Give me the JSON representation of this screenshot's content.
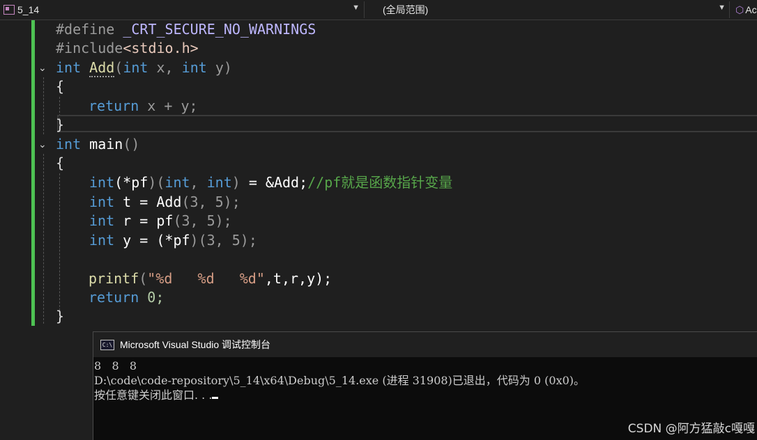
{
  "navbar": {
    "project": "5_14",
    "scope": "(全局范围)",
    "member": "Ac"
  },
  "code": {
    "l1": {
      "pre": "#define",
      "macro": "_CRT_SECURE_NO_WARNINGS"
    },
    "l2": {
      "pre": "#include",
      "file": "<stdio.h>"
    },
    "l3": {
      "kw1": "int",
      "fn": "Add",
      "p1": "(",
      "kw2": "int",
      "x": "x,",
      "kw3": "int",
      "y": "y)"
    },
    "l4": "{",
    "l5": {
      "kw": "return",
      "expr": "x + y;"
    },
    "l6": "}",
    "l7": {
      "kw": "int",
      "fn": "main",
      "paren": "()"
    },
    "l8": "{",
    "l9": {
      "kw1": "int",
      "a": "(*",
      "pf": "pf",
      "b": ")",
      "c": "(",
      "kw2": "int",
      "d": ", ",
      "kw3": "int",
      "e": ")",
      "f": " = &",
      "fn": "Add",
      "g": ";",
      "cm": "//pf就是函数指针变量"
    },
    "l10": {
      "kw": "int",
      "v": "t",
      "eq": " = ",
      "fn": "Add",
      "args": "(3, 5);"
    },
    "l11": {
      "kw": "int",
      "v": "r",
      "eq": " = ",
      "fn": "pf",
      "args": "(3, 5);"
    },
    "l12": {
      "kw": "int",
      "v": "y",
      "eq": " = (*",
      "fn": "pf",
      "args": ")(3, 5);"
    },
    "l14": {
      "fn": "printf",
      "p": "(",
      "str": "\"%d   %d   %d\"",
      "args": ",t,r,y);"
    },
    "l15": {
      "kw": "return",
      "rest": " 0;"
    },
    "l16": "}"
  },
  "console": {
    "title": "Microsoft Visual Studio 调试控制台",
    "icon": "C:\\",
    "line1": "8   8   8",
    "line2": "D:\\code\\code-repository\\5_14\\x64\\Debug\\5_14.exe (进程 31908)已退出，代码为 0 (0x0)。",
    "line3": "按任意键关闭此窗口. . ."
  },
  "watermark": "CSDN @阿方猛敲c嘎嘎"
}
